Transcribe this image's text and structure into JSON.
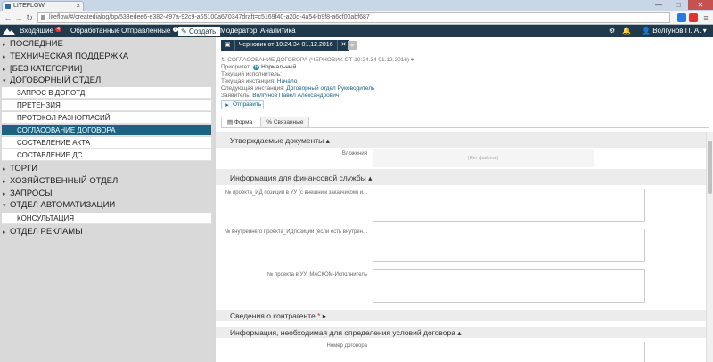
{
  "browser": {
    "tab_title": "LITEFLOW",
    "url": "liteflow/#/createdialog/bp/533edee6-e382-497a-92c9-a65100a670347draft=c5169f40-a20d-4a54-b9f8-a6cf00abf687",
    "window_controls": [
      "—",
      "□",
      "✕"
    ]
  },
  "nav": {
    "inbox_label": "Входящие",
    "inbox_badge": "4",
    "processed_label": "Обработанные",
    "sent_label": "Отправленные",
    "sent_badge": "1",
    "create_label": "Создать",
    "moderator_label": "Модератор",
    "analytics_label": "Аналитика",
    "user_name": "Волгунов П. А."
  },
  "sidebar": {
    "categories": [
      {
        "label": "ПОСЛЕДНИЕ"
      },
      {
        "label": "ТЕХНИЧЕСКАЯ ПОДДЕРЖКА"
      },
      {
        "label": "[БЕЗ КАТЕГОРИИ]"
      },
      {
        "label": "ДОГОВОРНЫЙ ОТДЕЛ"
      },
      {
        "label": "ТОРГИ"
      },
      {
        "label": "ХОЗЯЙСТВЕННЫЙ ОТДЕЛ"
      },
      {
        "label": "ЗАПРОСЫ"
      },
      {
        "label": "ОТДЕЛ АВТОМАТИЗАЦИИ"
      },
      {
        "label": "ОТДЕЛ РЕКЛАМЫ"
      }
    ],
    "contract_items": [
      {
        "label": "ЗАПРОС В ДОГ.ОТД."
      },
      {
        "label": "ПРЕТЕНЗИЯ"
      },
      {
        "label": "ПРОТОКОЛ РАЗНОГЛАСИЙ"
      },
      {
        "label": "СОГЛАСОВАНИЕ ДОГОВОРА"
      },
      {
        "label": "СОСТАВЛЕНИЕ АКТА"
      },
      {
        "label": "СОСТАВЛЕНИЕ ДС"
      }
    ],
    "automation_items": [
      {
        "label": "КОНСУЛЬТАЦИЯ"
      }
    ]
  },
  "draft": {
    "title": "Черновик от 10:24.34 01.12.2016",
    "close": "✕"
  },
  "doc": {
    "heading": "СОГЛАСОВАНИЕ ДОГОВОРА (ЧЕРНОВИК ОТ 10:24.34 01.12.2016)",
    "priority_label": "Приоритет:",
    "priority_badge": "Н",
    "priority_value": "Нормальный",
    "executor_label": "Текущий исполнитель:",
    "instance_label": "Текущая инстанция:",
    "instance_value": "Начало",
    "next_label": "Следующая инстанция:",
    "next_value": "Договорный отдел Руководитель",
    "applicant_label": "Заявитель:",
    "applicant_value": "Волгунов Павел Александрович",
    "send_label": "Отправить"
  },
  "tabs": [
    {
      "label": "Форма"
    },
    {
      "label": "Связанные"
    }
  ],
  "form": {
    "sec1_title": "Утверждаемые документы",
    "attachments_label": "Вложения",
    "no_files": "(Нет файлов)",
    "sec2_title": "Информация для финансовой службы",
    "f1_label": "№ проекта_ИД позиции в УУ (с внешним заказчиком) и...",
    "f2_label": "№ внутреннего проекта_ИДпозиции (если есть внутрен...",
    "f3_label": "№ проекта в УУ: МАСКОМ-Исполнитель",
    "sec3_title": "Сведения о контрагенте",
    "sec3_marker": "*",
    "sec4_title": "Информация, необходимая для определения условий договора",
    "contract_no_label": "Номер договора",
    "collapse_marker": "▴",
    "expand_marker": "▸"
  },
  "colors": {
    "nav_bg": "#1f3a4d",
    "active_item": "#1a6381",
    "badge_red": "#e33333"
  }
}
